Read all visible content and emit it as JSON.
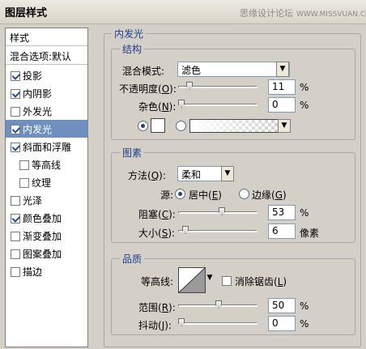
{
  "window": {
    "title": "图层样式"
  },
  "watermark": {
    "text": "思缘设计论坛",
    "site": "WWW.MISSVUAN.COM"
  },
  "left_panel": {
    "header": "样式",
    "subheader": "混合选项:默认",
    "items": [
      {
        "label": "投影",
        "checked": true
      },
      {
        "label": "内阴影",
        "checked": true
      },
      {
        "label": "外发光",
        "checked": false
      },
      {
        "label": "内发光",
        "checked": true,
        "selected": true
      },
      {
        "label": "斜面和浮雕",
        "checked": true
      },
      {
        "label": "等高线",
        "checked": false,
        "indent": true
      },
      {
        "label": "纹理",
        "checked": false,
        "indent": true
      },
      {
        "label": "光泽",
        "checked": false
      },
      {
        "label": "颜色叠加",
        "checked": true
      },
      {
        "label": "渐变叠加",
        "checked": false
      },
      {
        "label": "图案叠加",
        "checked": false
      },
      {
        "label": "描边",
        "checked": false
      }
    ]
  },
  "inner_glow": {
    "section_title": "内发光",
    "structure": {
      "title": "结构",
      "blend_mode_label": "混合模式:",
      "blend_mode_value": "滤色",
      "opacity_label_pre": "不透明度(",
      "opacity_key": "O",
      "opacity_label_post": "):",
      "opacity_value": "11",
      "opacity_unit": "%",
      "noise_label_pre": "杂色(",
      "noise_key": "N",
      "noise_label_post": "):",
      "noise_value": "0",
      "noise_unit": "%",
      "color_mode": "solid"
    },
    "elements": {
      "title": "图素",
      "method_label_pre": "方法(",
      "method_key": "Q",
      "method_label_post": "):",
      "method_value": "柔和",
      "source_label": "源:",
      "source_center_pre": "居中(",
      "source_center_key": "E",
      "source_center_post": ")",
      "source_edge_pre": "边缘(",
      "source_edge_key": "G",
      "source_edge_post": ")",
      "source_selected": "center",
      "choke_label_pre": "阻塞(",
      "choke_key": "C",
      "choke_label_post": "):",
      "choke_value": "53",
      "choke_unit": "%",
      "size_label_pre": "大小(",
      "size_key": "S",
      "size_label_post": "):",
      "size_value": "6",
      "size_unit": "像素"
    },
    "quality": {
      "title": "品质",
      "contour_label": "等高线:",
      "antialias_label_pre": "消除锯齿(",
      "antialias_key": "L",
      "antialias_label_post": ")",
      "antialias_checked": false,
      "range_label_pre": "范围(",
      "range_key": "R",
      "range_label_post": "):",
      "range_value": "50",
      "range_unit": "%",
      "jitter_label_pre": "抖动(",
      "jitter_key": "J",
      "jitter_label_post": "):",
      "jitter_value": "0",
      "jitter_unit": "%"
    }
  },
  "colors": {
    "accent": "#1e3f8c",
    "selection": "#6f8fbf",
    "dialog_bg": "#d4d0c8"
  }
}
